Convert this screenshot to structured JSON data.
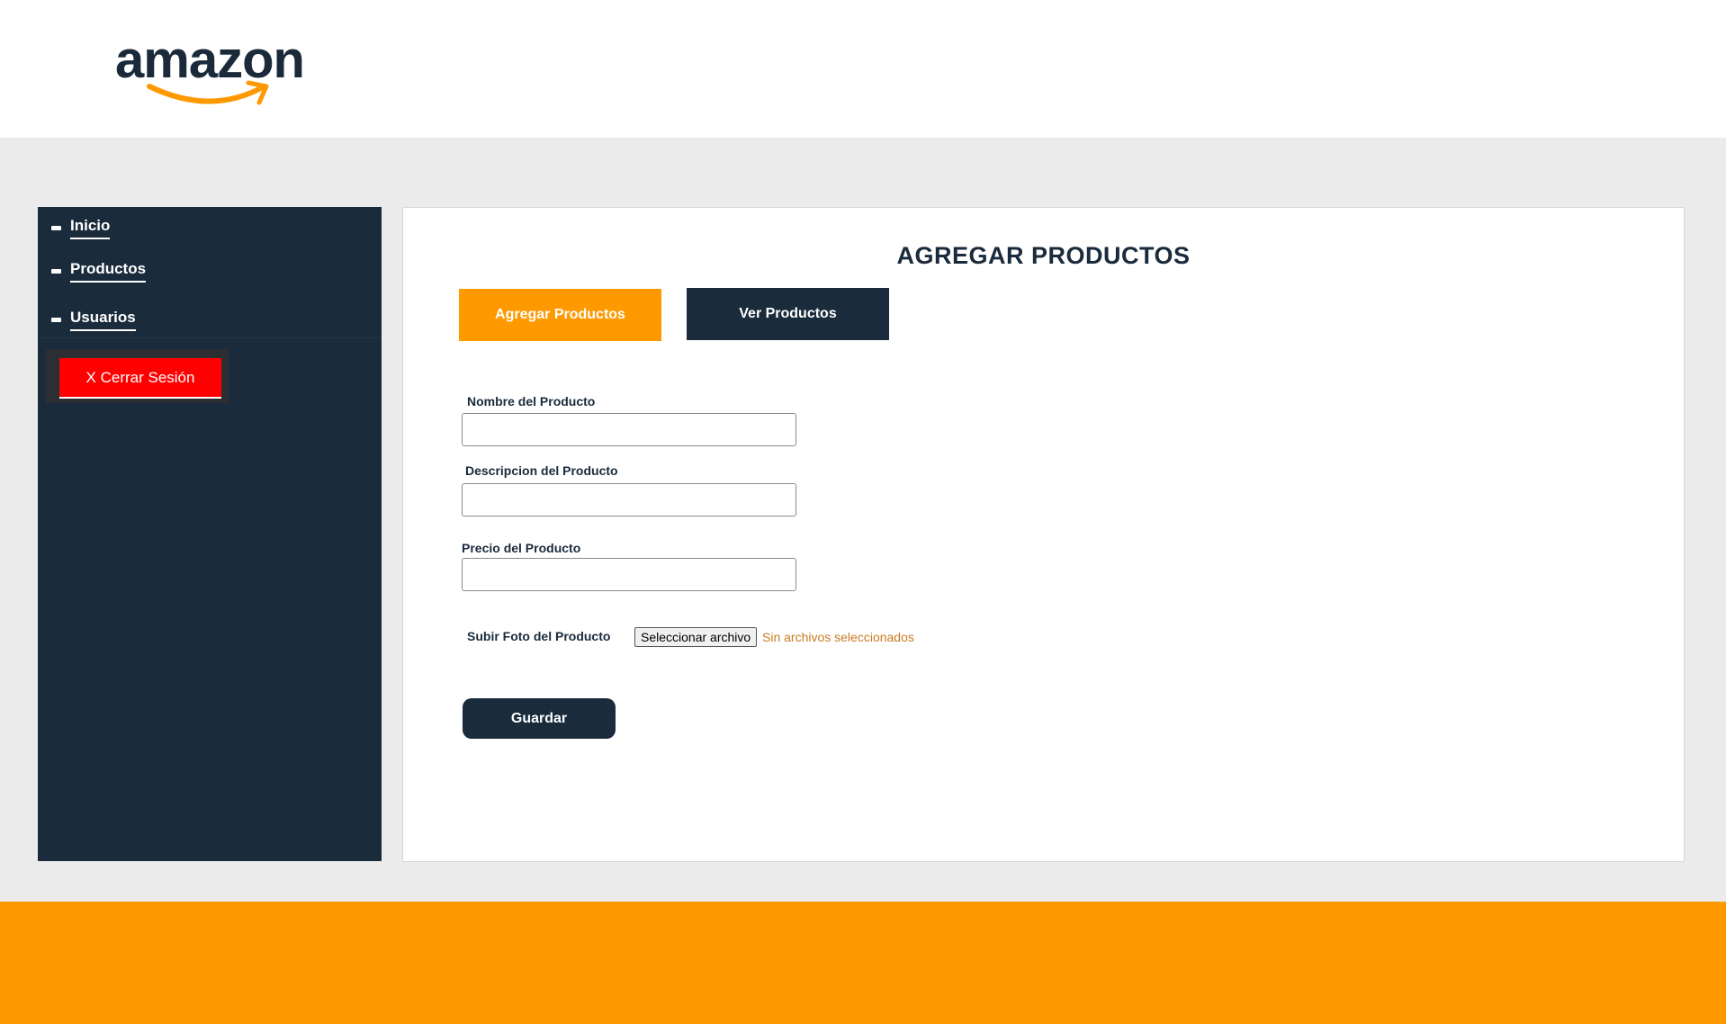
{
  "header": {
    "logo_text": "amazon",
    "logo_icon": "amazon-smile-arrow"
  },
  "sidebar": {
    "items": [
      {
        "label": "Inicio",
        "icon": "dash-bullet"
      },
      {
        "label": "Productos",
        "icon": "dash-bullet"
      },
      {
        "label": "Usuarios",
        "icon": "dash-bullet"
      }
    ],
    "logout_label": "X Cerrar Sesión"
  },
  "main": {
    "title": "AGREGAR PRODUCTOS",
    "tabs": {
      "add_label": "Agregar Productos",
      "view_label": "Ver Productos"
    },
    "form": {
      "name_label": "Nombre del Producto",
      "name_value": "",
      "description_label": "Descripcion del Producto",
      "description_value": "",
      "price_label": "Precio del Producto",
      "price_value": "",
      "photo_label": "Subir Foto del Producto",
      "file_button_label": "Seleccionar archivo",
      "file_status": "Sin archivos seleccionados",
      "save_label": "Guardar"
    }
  },
  "colors": {
    "navy": "#1a2b3c",
    "orange": "#ff9900",
    "red": "#ff0000",
    "background": "#ebebeb",
    "file_status_text": "#c87b22"
  }
}
